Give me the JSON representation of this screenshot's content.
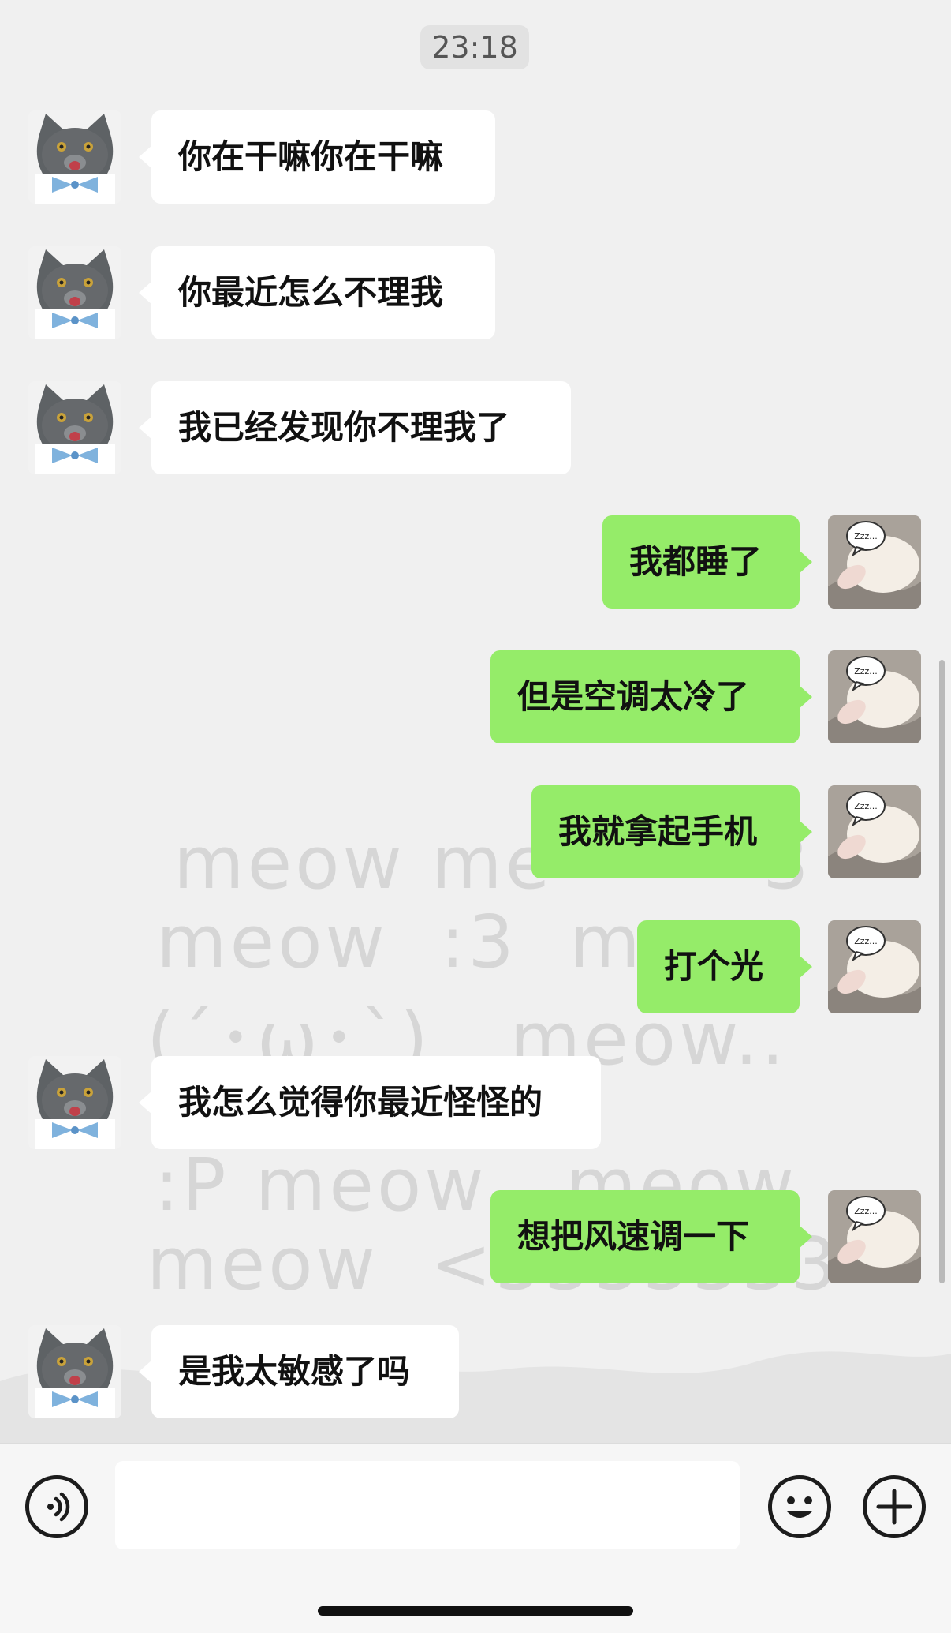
{
  "timestamp": "23:18",
  "wallpaper_lines": [
    "meow me        3",
    "meow  :3  meow",
    "(´･ω･`)   meow..",
    "                !??",
    ":P meow   meow",
    "meow  <3333333"
  ],
  "messages": [
    {
      "side": "incoming",
      "text": "你在干嘛你在干嘛",
      "avatar": "cat-avatar"
    },
    {
      "side": "incoming",
      "text": "你最近怎么不理我",
      "avatar": "cat-avatar"
    },
    {
      "side": "incoming",
      "text": "我已经发现你不理我了",
      "avatar": "cat-avatar"
    },
    {
      "side": "outgoing",
      "text": "我都睡了",
      "avatar": "bunny-avatar"
    },
    {
      "side": "outgoing",
      "text": "但是空调太冷了",
      "avatar": "bunny-avatar"
    },
    {
      "side": "outgoing",
      "text": "我就拿起手机",
      "avatar": "bunny-avatar"
    },
    {
      "side": "outgoing",
      "text": "打个光",
      "avatar": "bunny-avatar"
    },
    {
      "side": "incoming",
      "text": "我怎么觉得你最近怪怪的",
      "avatar": "cat-avatar"
    },
    {
      "side": "outgoing",
      "text": "想把风速调一下",
      "avatar": "bunny-avatar"
    },
    {
      "side": "incoming",
      "text": "是我太敏感了吗",
      "avatar": "cat-avatar"
    }
  ],
  "bunny_speech_text": "Zzz...",
  "input_bar": {
    "text_value": "",
    "voice_icon": "voice-icon",
    "emoji_icon": "emoji-icon",
    "plus_icon": "plus-icon"
  },
  "colors": {
    "outgoing_bubble": "#95ec69",
    "incoming_bubble": "#ffffff",
    "chat_background": "#f0f0f0"
  }
}
